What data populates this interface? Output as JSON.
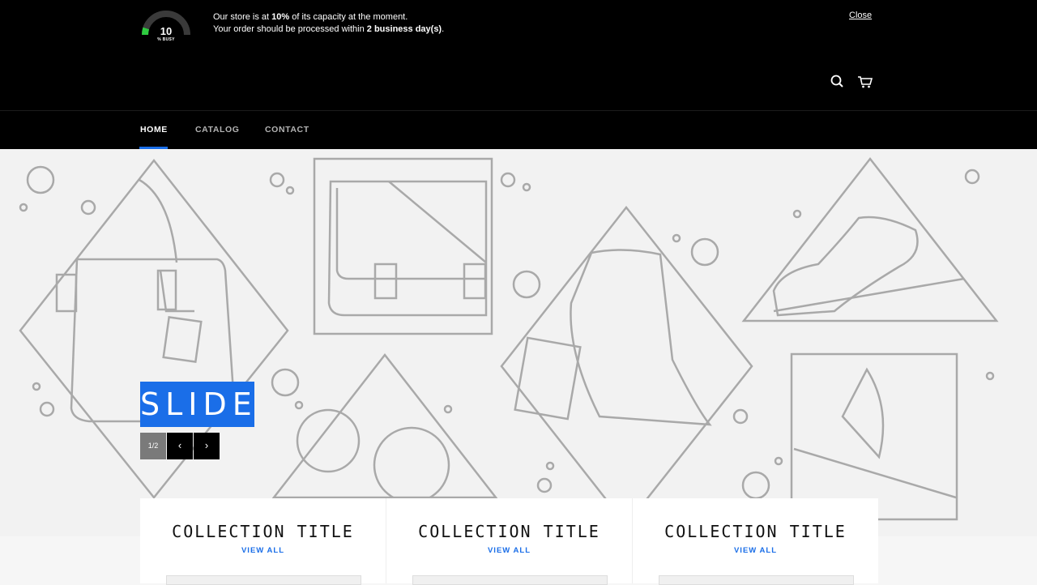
{
  "banner": {
    "gauge_value": "10",
    "gauge_caption": "% BUSY",
    "capacity_fraction": 0.1,
    "line1_pre": "Our store is at ",
    "line1_bold": "10%",
    "line1_post": " of its capacity at the moment.",
    "line2_pre": "Your order should be processed within ",
    "line2_bold": "2 business day(s)",
    "line2_post": ".",
    "close_label": "Close"
  },
  "header": {
    "icons": [
      "search-icon",
      "cart-icon"
    ]
  },
  "nav": {
    "items": [
      {
        "label": "HOME",
        "active": true
      },
      {
        "label": "CATALOG",
        "active": false
      },
      {
        "label": "CONTACT",
        "active": false
      }
    ]
  },
  "hero": {
    "slide_title": "SLIDE",
    "counter": "1/2",
    "prev_icon": "‹",
    "next_icon": "›"
  },
  "collections": [
    {
      "title": "COLLECTION TITLE",
      "link": "VIEW ALL"
    },
    {
      "title": "COLLECTION TITLE",
      "link": "VIEW ALL"
    },
    {
      "title": "COLLECTION TITLE",
      "link": "VIEW ALL"
    }
  ],
  "colors": {
    "accent": "#1a6ee8",
    "gauge_fill": "#2ecc40",
    "header_bg": "#000000",
    "hero_bg": "#f2f2f2"
  }
}
